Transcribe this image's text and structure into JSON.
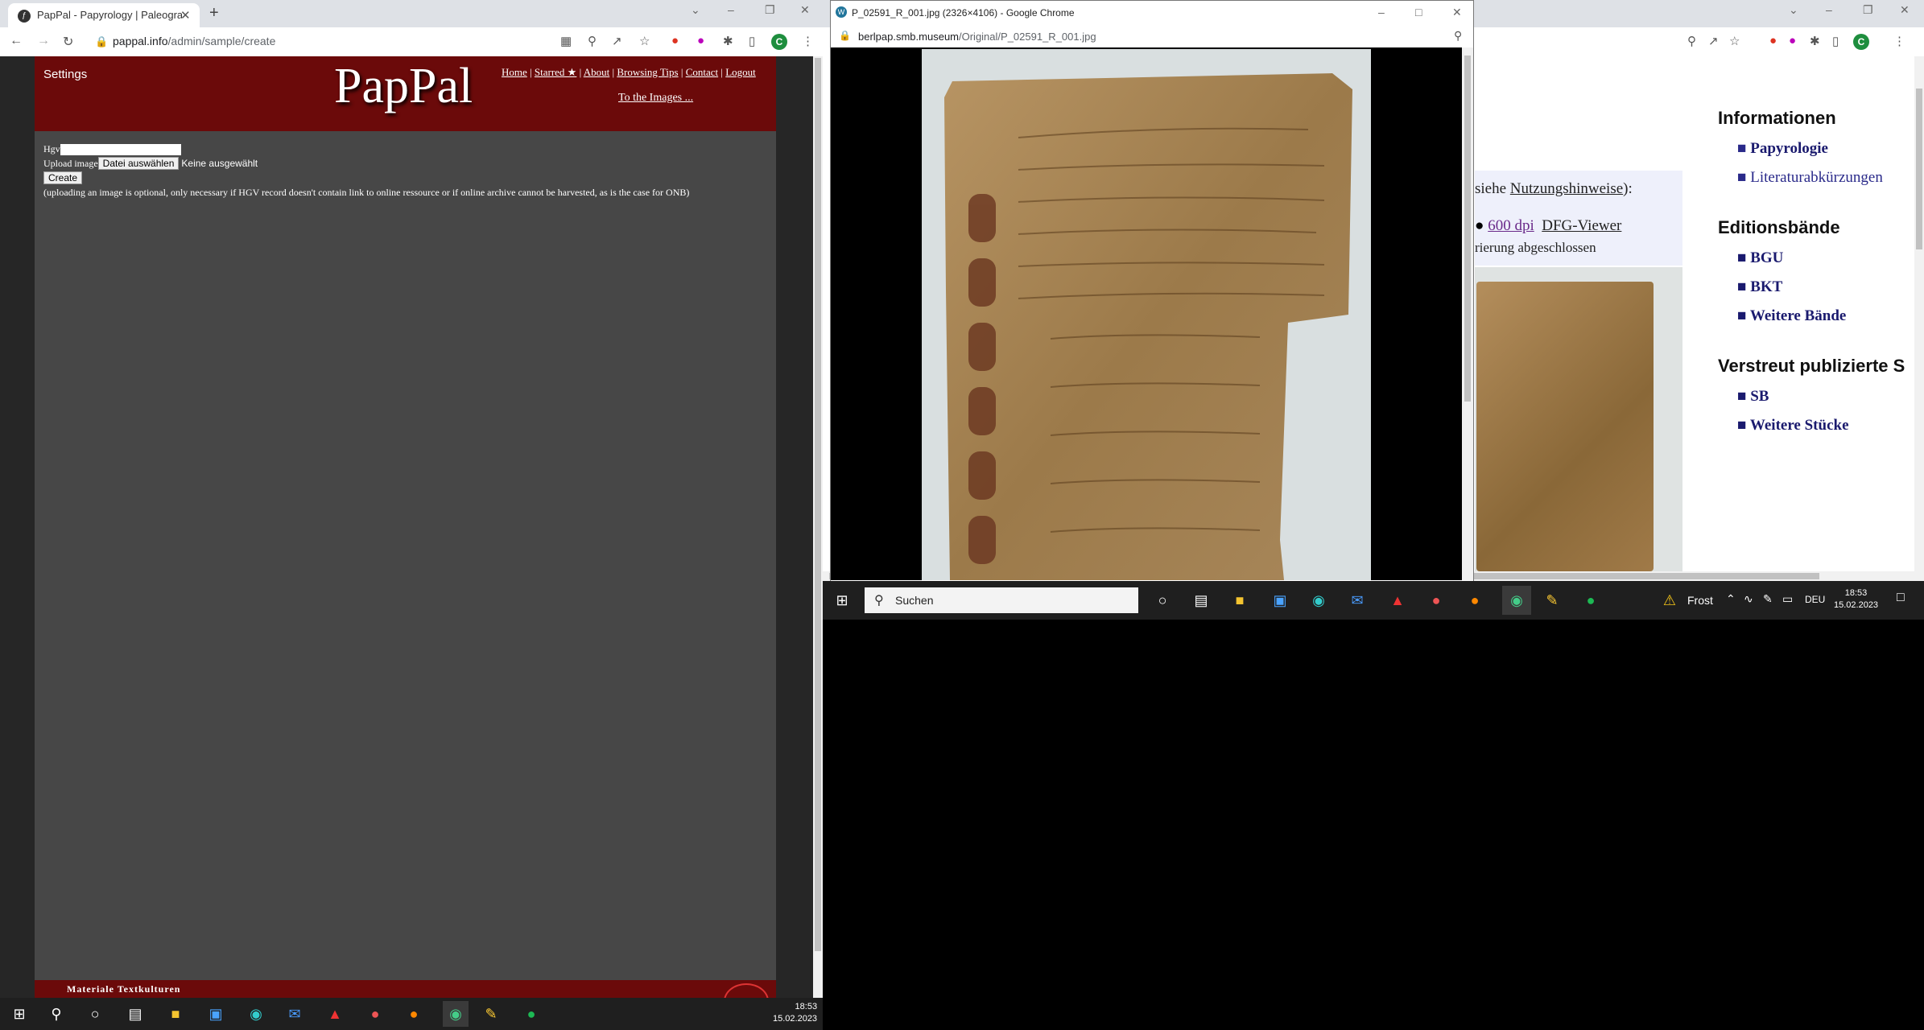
{
  "left_browser": {
    "tab_title": "PapPal - Papyrology | Paleograph",
    "url_host": "pappal.info",
    "url_path": "/admin/sample/create",
    "avatar_letter": "C"
  },
  "pappal": {
    "settings": "Settings",
    "logo": "PapPal",
    "menu": [
      "Home",
      "Starred ★",
      "About",
      "Browsing Tips",
      "Contact",
      "Logout"
    ],
    "to_images": "To the Images ...",
    "hgv_label": "Hgv",
    "upload_label": "Upload image",
    "file_button": "Datei auswählen",
    "file_status": "Keine ausgewählt",
    "create_button": "Create",
    "note": "(uploading an image is optional, only necessary if HGV record doesn't contain link to online ressource or if online archive cannot be harvested, as is the case for ONB)",
    "footer": "Materiale Textkulturen"
  },
  "popup": {
    "title": "P_02591_R_001.jpg (2326×4106) - Google Chrome",
    "url_host": "berlpap.smb.museum",
    "url_path": "/Original/P_02591_R_001.jpg"
  },
  "right_page": {
    "info_prefix": "siehe",
    "info_link": "Nutzungshinweise",
    "info_suffix": "):",
    "dpi_link": "600 dpi",
    "dfg_link": "DFG-Viewer",
    "status": "rierung abgeschlossen",
    "sections": [
      {
        "title": "Informationen",
        "links": [
          "Papyrologie",
          "Literaturabkürzungen"
        ]
      },
      {
        "title": "Editionsbände",
        "links": [
          "BGU",
          "BKT",
          "Weitere Bände"
        ]
      },
      {
        "title": "Verstreut publizierte S",
        "links": [
          "SB",
          "Weitere Stücke"
        ]
      }
    ],
    "avatar_letter": "C"
  },
  "taskbar_right": {
    "search_placeholder": "Suchen",
    "weather": "Frost",
    "lang": "DEU",
    "time": "18:53",
    "date": "15.02.2023"
  },
  "taskbar_left": {
    "time": "18:53",
    "date": "15.02.2023"
  }
}
